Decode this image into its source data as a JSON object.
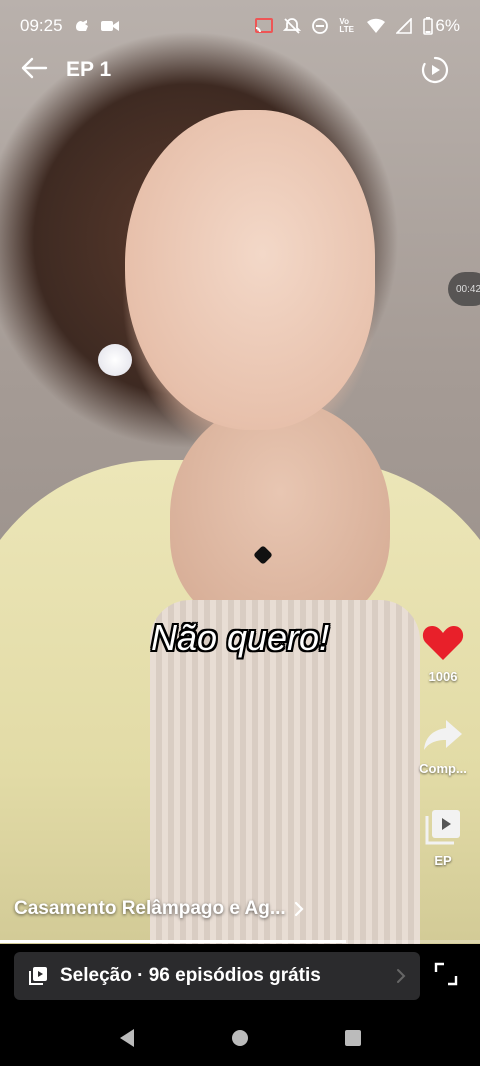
{
  "status_bar": {
    "time": "09:25",
    "battery": "6%",
    "left_icons": [
      "hand-icon",
      "video-camera-icon"
    ],
    "right_icons": [
      "cast-icon",
      "bell-off-icon",
      "dnd-icon",
      "volte-icon",
      "wifi-icon",
      "signal-icon",
      "battery-icon"
    ],
    "volte_text": "Vo LTE"
  },
  "header": {
    "episode_title": "EP 1"
  },
  "video": {
    "subtitle": "Não quero!",
    "time_pill": "00:42",
    "progress_fraction": 0.72
  },
  "side_actions": {
    "likes": "1006",
    "share_label": "Comp...",
    "episodes_label": "EP",
    "like_color": "#e8202a"
  },
  "show": {
    "title": "Casamento Relâmpago e Ag..."
  },
  "selection": {
    "label": "Seleção · 96 episódios grátis"
  }
}
